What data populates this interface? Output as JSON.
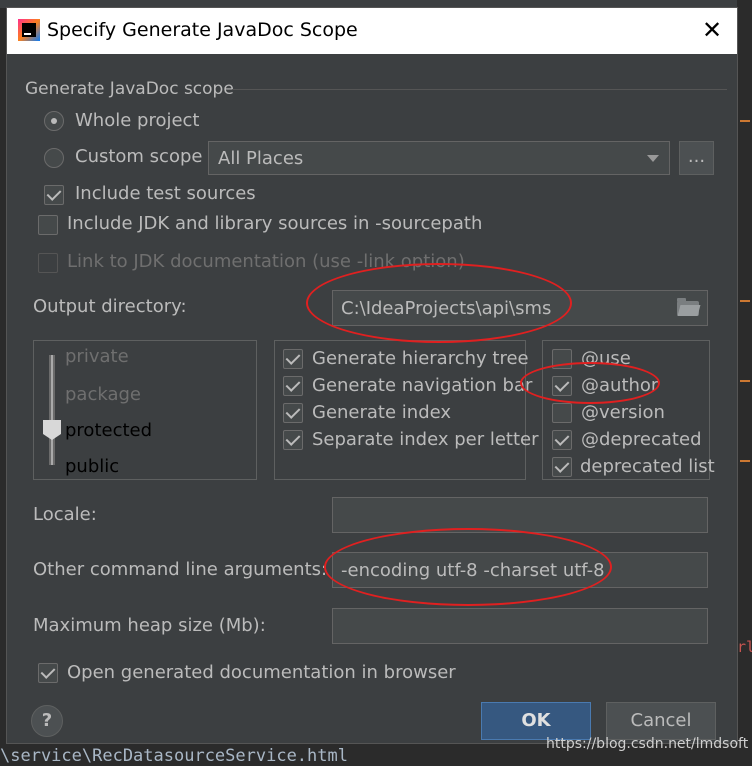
{
  "dialog": {
    "title": "Specify Generate JavaDoc Scope",
    "close_icon": "close-icon"
  },
  "scope": {
    "section_label": "Generate JavaDoc scope",
    "whole_project": "Whole project",
    "custom_scope": "Custom scope",
    "custom_scope_value": "All Places",
    "browse_label": "...",
    "include_test_sources": "Include test sources",
    "include_jdk": "Include JDK and library sources in -sourcepath",
    "link_jdk": "Link to JDK documentation (use -link option)"
  },
  "output": {
    "label": "Output directory:",
    "value": "C:\\IdeaProjects\\api\\sms"
  },
  "visibility": {
    "levels": [
      "private",
      "package",
      "protected",
      "public"
    ],
    "selected": "protected"
  },
  "generate_options": [
    {
      "label": "Generate hierarchy tree",
      "checked": true
    },
    {
      "label": "Generate navigation bar",
      "checked": true
    },
    {
      "label": "Generate index",
      "checked": true
    },
    {
      "label": "Separate index per letter",
      "checked": true
    }
  ],
  "tag_options": [
    {
      "label": "@use",
      "checked": false
    },
    {
      "label": "@author",
      "checked": true
    },
    {
      "label": "@version",
      "checked": false
    },
    {
      "label": "@deprecated",
      "checked": true
    },
    {
      "label": "deprecated list",
      "checked": true
    }
  ],
  "locale": {
    "label": "Locale:",
    "value": ""
  },
  "other_args": {
    "label": "Other command line arguments:",
    "value": "-encoding utf-8 -charset utf-8"
  },
  "heap": {
    "label": "Maximum heap size (Mb):",
    "value": ""
  },
  "open_browser": "Open generated documentation in browser",
  "buttons": {
    "help": "?",
    "ok": "OK",
    "cancel": "Cancel"
  },
  "background": {
    "bottom_text": "\\service\\RecDatasourceService.html",
    "right_glyph": "rl林"
  },
  "watermark": "https://blog.csdn.net/lmdsoft",
  "colors": {
    "accent_ok": "#365880",
    "annotation_red": "#e02020"
  }
}
